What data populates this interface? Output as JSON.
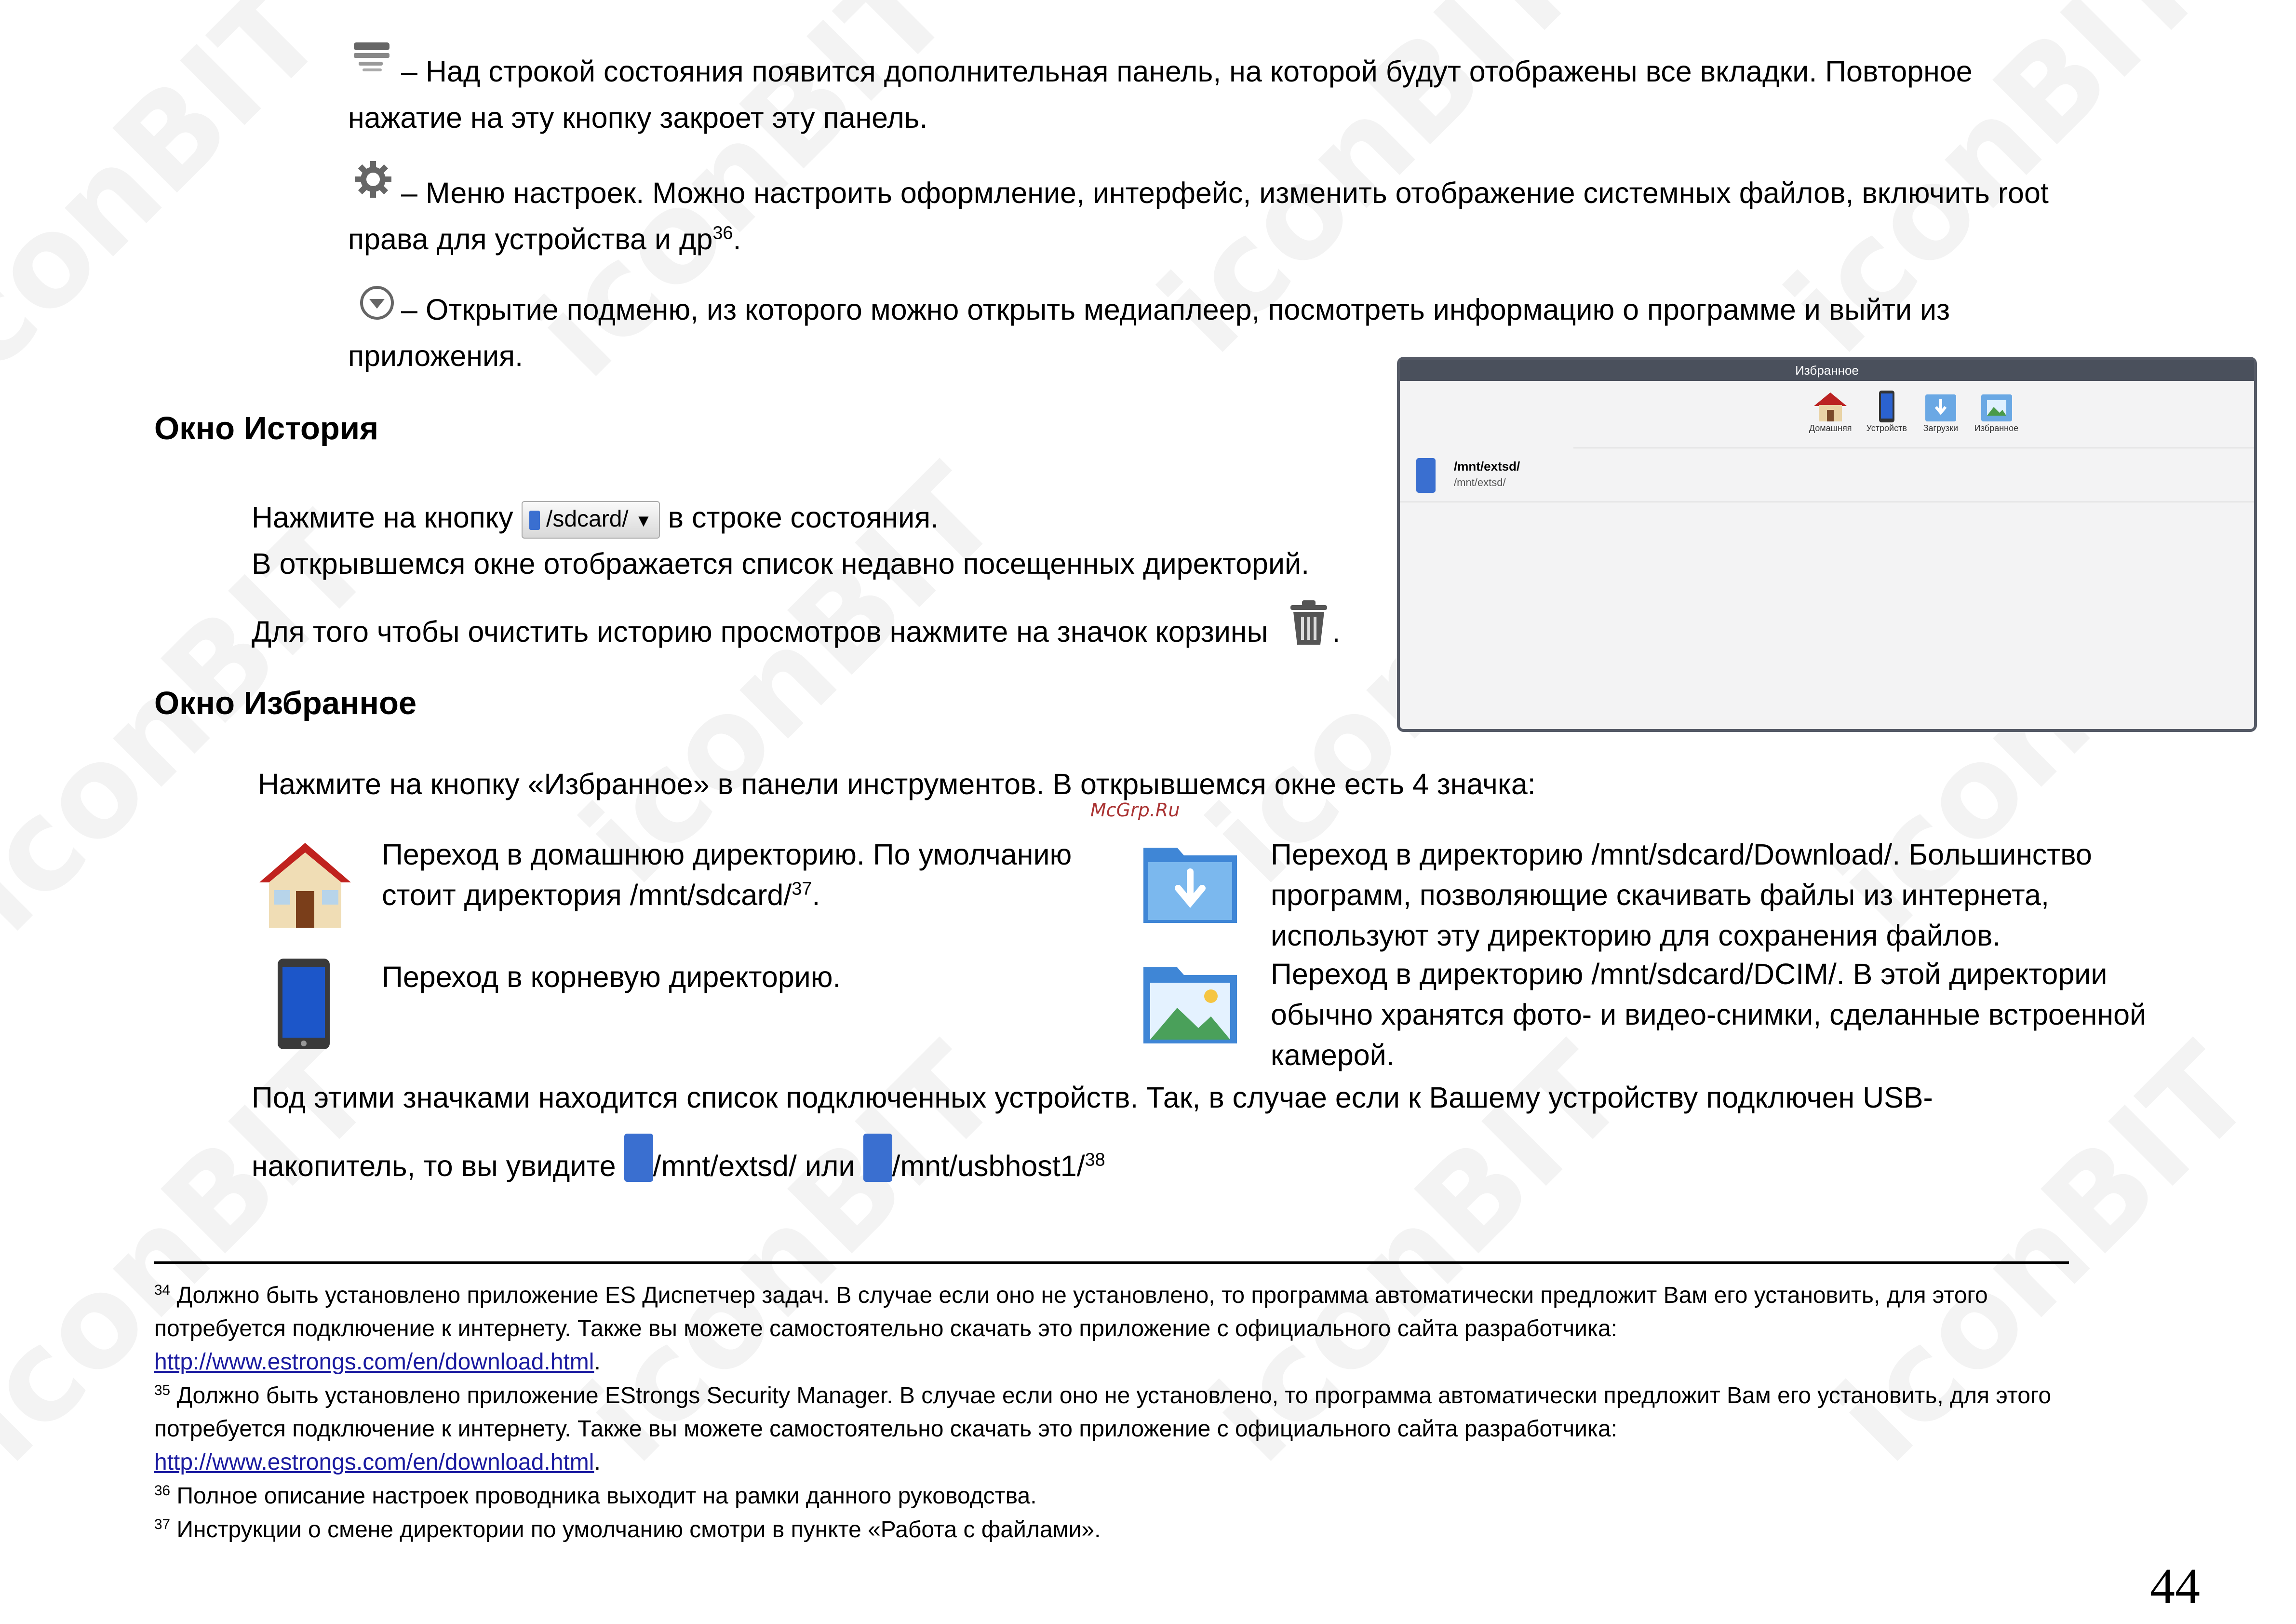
{
  "intro": {
    "tabs_text": "– Над строкой состояния появится дополнительная панель, на которой будут отображены все вкладки.  Повторное нажатие на эту кнопку закроет эту панель.",
    "settings_text": "– Меню настроек. Можно настроить оформление, интерфейс, изменить отображение системных файлов, включить root права для устройства и др",
    "settings_sup": "36",
    "submenu_text": "– Открытие подменю, из которого можно открыть медиаплеер, посмотреть информацию о программе и выйти из приложения."
  },
  "history": {
    "heading": "Окно История",
    "line1_a": "Нажмите на кнопку",
    "button_label": "/sdcard/",
    "line1_b": "в строке состояния.",
    "line2": "В открывшемся окне отображается  список недавно посещенных директорий.",
    "line3": "Для того чтобы очистить историю просмотров нажмите на значок корзины",
    "line3_end": "."
  },
  "favorites_panel": {
    "title": "Избранное",
    "icons": [
      "Домашняя",
      "Устройств",
      "Загрузки",
      "Избранное"
    ],
    "entry_main": "/mnt/extsd/",
    "entry_sub": "/mnt/extsd/"
  },
  "favorites": {
    "heading": "Окно Избранное",
    "intro": "Нажмите на кнопку «Избранное» в панели инструментов. В открывшемся окне есть 4 значка:",
    "watermark_site": "McGrp.Ru",
    "home_text": "Переход в домашнюю директорию. По умолчанию стоит директория /mnt/sdcard/",
    "home_sup": "37",
    "home_end": ".",
    "root_text": "Переход в корневую директорию.",
    "download_text": "Переход в директорию /mnt/sdcard/Download/. Большинство программ, позволяющие скачивать файлы из интернета, используют эту директорию для сохранения файлов.",
    "dcim_text": "Переход в директорию /mnt/sdcard/DCIM/. В этой директории обычно хранятся фото- и видео-снимки, сделанные встроенной камерой.",
    "devices_line1": "Под этими значками находится список подключенных устройств. Так, в случае если к Вашему устройству подключен USB-",
    "devices_line2_a": "накопитель, то вы увидите",
    "devices_extsd": "/mnt/extsd/ или",
    "devices_usb": "/mnt/usbhost1/",
    "devices_sup": "38"
  },
  "footnotes": [
    {
      "num": "34",
      "text": "Должно быть установлено приложение ES Диспетчер задач. В случае если оно не установлено, то программа автоматически предложит Вам его установить, для этого потребуется подключение к интернету. Также вы можете самостоятельно скачать это приложение с официального сайта разработчика:",
      "link": "http://www.estrongs.com/en/download.html",
      "end": "."
    },
    {
      "num": "35",
      "text": "Должно быть установлено приложение EStrongs Security Manager. В случае если оно не установлено, то программа автоматически предложит Вам его установить, для этого потребуется подключение к интернету. Также вы можете самостоятельно скачать это приложение с официального сайта разработчика:",
      "link": "http://www.estrongs.com/en/download.html",
      "end": "."
    },
    {
      "num": "36",
      "text": "Полное описание настроек проводника выходит на рамки данного руководства."
    },
    {
      "num": "37",
      "text": "Инструкции о смене директории по умолчанию смотри в пункте «Работа с файлами»."
    }
  ],
  "watermark": "iconBIT",
  "page_number": "44"
}
